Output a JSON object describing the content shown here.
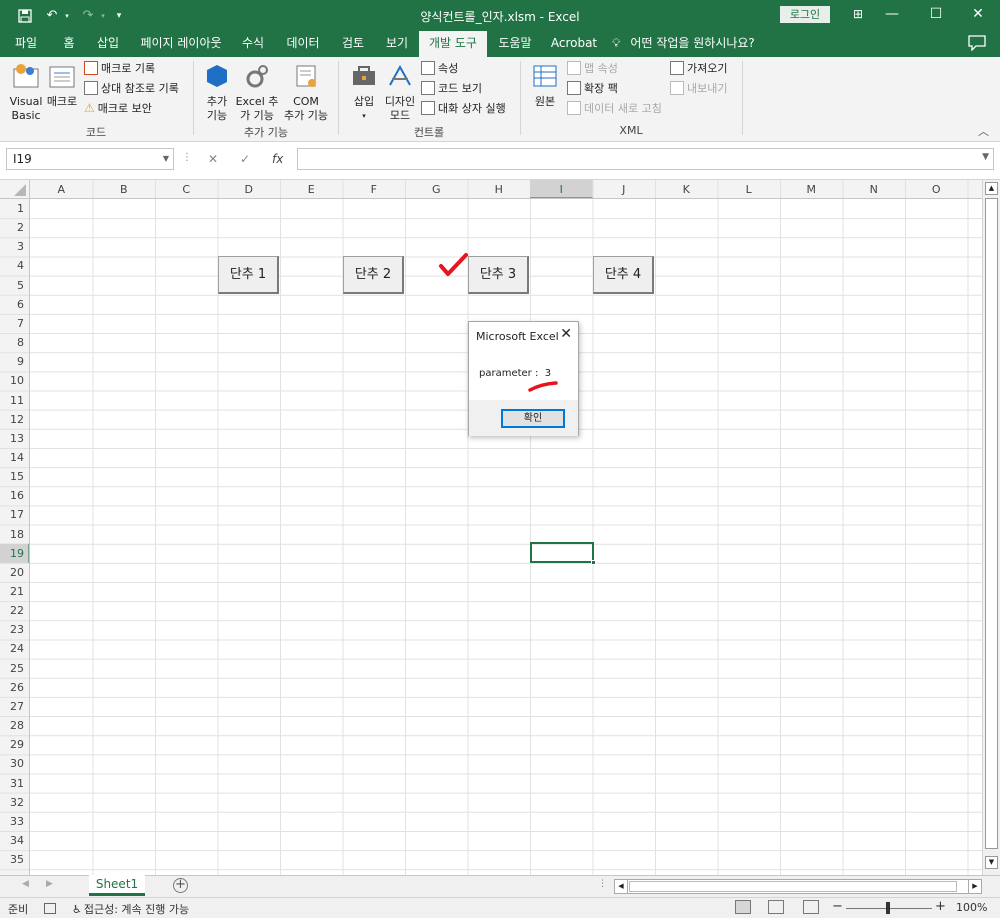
{
  "titlebar": {
    "title": "양식컨트롤_인자.xlsm  -  Excel",
    "login": "로그인",
    "save_icon": "save-icon",
    "undo_icon": "undo-icon",
    "redo_icon": "redo-icon",
    "customize_icon": "customize-qat-icon",
    "ribbon_display_icon": "ribbon-display-options-icon",
    "minimize_icon": "minimize-icon",
    "maximize_icon": "maximize-icon",
    "close_icon": "close-icon",
    "accent": "#217346"
  },
  "tabs": [
    "파일",
    "홈",
    "삽입",
    "페이지 레이아웃",
    "수식",
    "데이터",
    "검토",
    "보기",
    "개발 도구",
    "도움말",
    "Acrobat"
  ],
  "active_tab": "개발 도구",
  "tell_me": "어떤 작업을 원하시나요?",
  "ribbon": {
    "code": {
      "label": "코드",
      "visual_basic": "Visual\nBasic",
      "macros": "매크로",
      "record_macro": "매크로 기록",
      "relative_ref": "상대 참조로 기록",
      "macro_security": "매크로 보안"
    },
    "addins": {
      "label": "추가 기능",
      "addins": "추가\n기능",
      "excel_addins": "Excel 추\n가 기능",
      "com_addins": "COM\n추가 기능"
    },
    "controls": {
      "label": "컨트롤",
      "insert": "삽입",
      "design_mode": "디자인\n모드",
      "properties": "속성",
      "view_code": "코드 보기",
      "run_dialog": "대화 상자 실행"
    },
    "xml": {
      "label": "XML",
      "source": "원본",
      "map_properties": "맵 속성",
      "expansion_packs": "확장 팩",
      "refresh_data": "데이터 새로 고침",
      "import": "가져오기",
      "export": "내보내기"
    }
  },
  "formula_bar": {
    "name_box": "I19",
    "cancel": "✕",
    "enter": "✓",
    "fx": "fx",
    "value": ""
  },
  "sheet": {
    "columns": [
      "A",
      "B",
      "C",
      "D",
      "E",
      "F",
      "G",
      "H",
      "I",
      "J",
      "K",
      "L",
      "M",
      "N",
      "O"
    ],
    "rows": [
      "1",
      "2",
      "3",
      "4",
      "5",
      "6",
      "7",
      "8",
      "9",
      "10",
      "11",
      "12",
      "13",
      "14",
      "15",
      "16",
      "17",
      "18",
      "19",
      "20",
      "21",
      "22",
      "23",
      "24",
      "25",
      "26",
      "27",
      "28",
      "29",
      "30",
      "31",
      "32",
      "33",
      "34",
      "35"
    ],
    "selected_cell": "I19",
    "buttons": [
      {
        "label": "단추 1"
      },
      {
        "label": "단추 2"
      },
      {
        "label": "단추 3"
      },
      {
        "label": "단추 4"
      }
    ],
    "annotation_color": "#e8141e"
  },
  "dialog": {
    "title": "Microsoft Excel",
    "message": "parameter :  3",
    "ok": "확인"
  },
  "sheet_tabs": [
    "Sheet1"
  ],
  "statusbar": {
    "ready": "준비",
    "accessibility": "접근성: 계속 진행 가능",
    "zoom": "100%",
    "zoom_minus": "−",
    "zoom_plus": "+"
  }
}
